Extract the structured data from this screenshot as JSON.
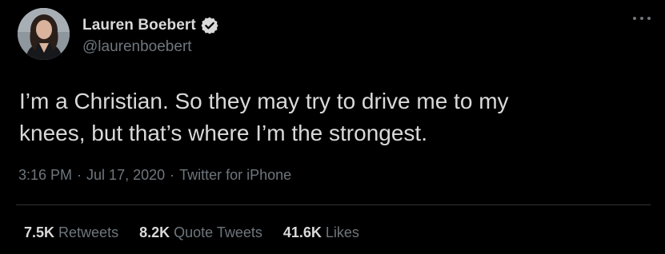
{
  "author": {
    "display_name": "Lauren Boebert",
    "handle": "@laurenboebert",
    "verified": true
  },
  "menu_icon": "more-horizontal-icon",
  "tweet": {
    "text_line1": "I’m a Christian. So they may try to drive me to my",
    "text_line2": "knees, but that’s where I’m the strongest."
  },
  "meta": {
    "time": "3:16 PM",
    "separator": "·",
    "date": "Jul 17, 2020",
    "source": "Twitter for iPhone"
  },
  "stats": [
    {
      "count": "7.5K",
      "label": "Retweets"
    },
    {
      "count": "8.2K",
      "label": "Quote Tweets"
    },
    {
      "count": "41.6K",
      "label": "Likes"
    }
  ],
  "colors": {
    "background": "#000000",
    "primary_text": "#d9d9d9",
    "secondary_text": "#6e767d",
    "verified_badge": "#d9d9d9",
    "divider": "#2f3336"
  }
}
